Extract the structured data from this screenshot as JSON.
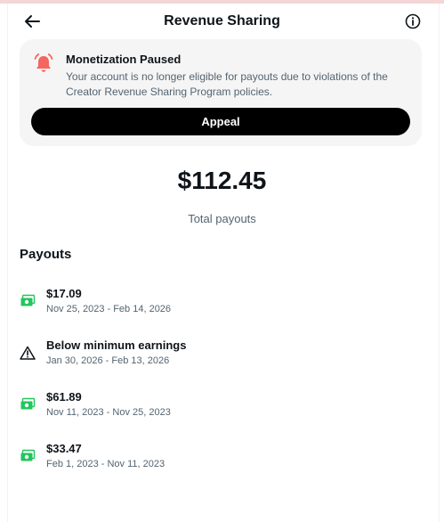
{
  "header": {
    "title": "Revenue Sharing",
    "back_icon": "back-arrow-icon",
    "info_icon": "info-icon"
  },
  "notice": {
    "icon": "bell-icon",
    "icon_color": "#f4665f",
    "title": "Monetization Paused",
    "text": "Your account is no longer eligible for payouts due to violations of the Creator Revenue Sharing Program policies.",
    "appeal_label": "Appeal"
  },
  "summary": {
    "total_amount": "$112.45",
    "total_label": "Total payouts"
  },
  "payouts": {
    "section_title": "Payouts",
    "items": [
      {
        "icon": "money-icon",
        "amount": "$17.09",
        "dates": "Nov 25, 2023 - Feb 14, 2026"
      },
      {
        "icon": "warning-icon",
        "amount": "Below minimum earnings",
        "dates": "Jan 30, 2026 - Feb 13, 2026"
      },
      {
        "icon": "money-icon",
        "amount": "$61.89",
        "dates": "Nov 11, 2023 - Nov 25, 2023"
      },
      {
        "icon": "money-icon",
        "amount": "$33.47",
        "dates": "Feb 1, 2023 - Nov 11, 2023"
      }
    ],
    "money_icon_color": "#22c55e"
  }
}
